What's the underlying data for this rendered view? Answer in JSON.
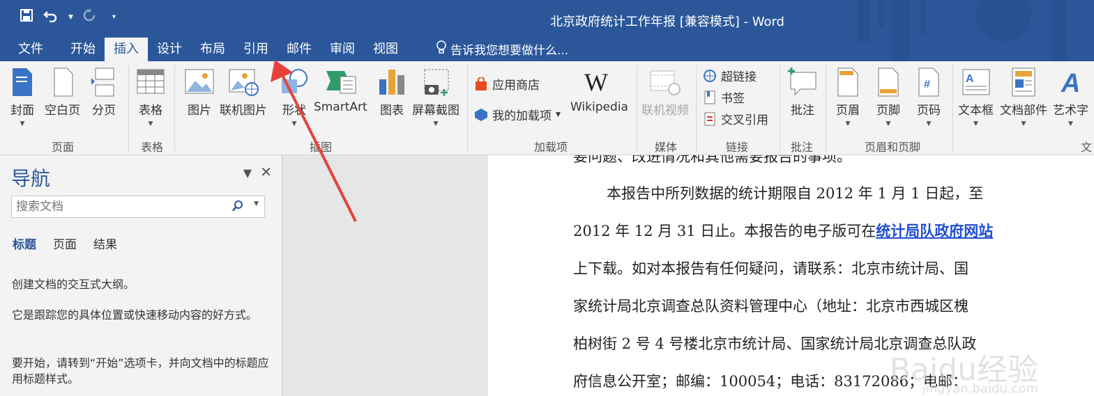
{
  "title": "北京政府统计工作年报 [兼容模式] - Word",
  "menu": {
    "tabs": [
      "文件",
      "开始",
      "插入",
      "设计",
      "布局",
      "引用",
      "邮件",
      "审阅",
      "视图"
    ],
    "tell_me": "告诉我您想要做什么..."
  },
  "ribbon": {
    "pages": {
      "cover": "封面",
      "blank": "空白页",
      "break": "分页",
      "group": "页面"
    },
    "tables": {
      "table": "表格",
      "group": "表格"
    },
    "illustrations": {
      "picture": "图片",
      "online_picture": "联机图片",
      "shapes": "形状",
      "smartart": "SmartArt",
      "chart": "图表",
      "screenshot": "屏幕截图",
      "group": "插图"
    },
    "addins": {
      "store": "应用商店",
      "my_addins": "我的加载项",
      "wikipedia": "Wikipedia",
      "group": "加载项"
    },
    "media": {
      "online_video": "联机视频",
      "group": "媒体"
    },
    "links": {
      "hyperlink": "超链接",
      "bookmark": "书签",
      "cross_ref": "交叉引用",
      "group": "链接"
    },
    "comments": {
      "comment": "批注",
      "group": "批注"
    },
    "header_footer": {
      "header": "页眉",
      "footer": "页脚",
      "page_number": "页码",
      "group": "页眉和页脚"
    },
    "text": {
      "textbox": "文本框",
      "quick_parts": "文档部件",
      "wordart": "艺术字",
      "group": "文"
    }
  },
  "nav": {
    "title": "导航",
    "search_placeholder": "搜索文档",
    "tabs": [
      "标题",
      "页面",
      "结果"
    ],
    "lines": [
      "创建文档的交互式大纲。",
      "它是跟踪您的具体位置或快速移动内容的好方式。",
      "要开始，请转到“开始”选项卡，并向文档中的标题应用标题样式。"
    ]
  },
  "doc": {
    "line0": "要问题、改进情况和其他需要报告的事项。",
    "line1": "本报告中所列数据的统计期限自 2012 年 1 月 1 日起，至",
    "line2a": "2012 年 12 月 31 日止。本报告的电子版可在",
    "line2link": "统计局队政府网站",
    "line3": "上下载。如对本报告有任何疑问，请联系：北京市统计局、国",
    "line4": "家统计局北京调查总队资料管理中心（地址：北京市西城区槐",
    "line5": "柏树街 2 号 4 号楼北京市统计局、国家统计局北京调查总队政",
    "line6": "府信息公开室；邮编：100054；电话：83172086；电邮："
  },
  "watermark": {
    "logo": "Baidu经验",
    "url": "jingyan.baidu.com"
  },
  "colors": {
    "brand": "#2b579a",
    "link": "#1f4ed1",
    "arrow": "#e8413b"
  }
}
